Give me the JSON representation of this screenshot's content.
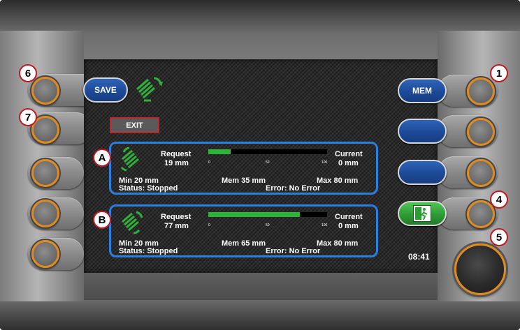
{
  "callouts": [
    "6",
    "7",
    "A",
    "B",
    "1",
    "4",
    "5"
  ],
  "softkeys": {
    "save_label": "SAVE",
    "mem_label": "MEM",
    "exit_label": "EXIT"
  },
  "panels": [
    {
      "marker": "A",
      "request_label": "Request",
      "request_value": "19 mm",
      "current_label": "Current",
      "current_value": "0 mm",
      "bar_fraction": 0.19,
      "tick_0": "0",
      "tick_50": "50",
      "tick_100": "100",
      "min": "Min 20 mm",
      "mem": "Mem 35 mm",
      "max": "Max 80 mm",
      "status": "Status: Stopped",
      "error": "Error: No Error"
    },
    {
      "marker": "B",
      "request_label": "Request",
      "request_value": "77 mm",
      "current_label": "Current",
      "current_value": "0 mm",
      "bar_fraction": 0.77,
      "tick_0": "0",
      "tick_50": "50",
      "tick_100": "100",
      "min": "Min 20 mm",
      "mem": "Mem 65 mm",
      "max": "Max 80 mm",
      "status": "Status: Stopped",
      "error": "Error: No Error"
    }
  ],
  "clock": "08:41",
  "icons": {
    "header": "brush-rotate-icon",
    "panel": "brush-rotate-icon",
    "exit": "emergency-exit-icon"
  },
  "colors": {
    "accent": "#2a7fe0",
    "softkey_blue": "#1d4a98",
    "exit_green": "#2e9c35",
    "bar_fill": "#2fb23a",
    "ring_orange": "#e08a22",
    "callout_red": "#c0191f"
  }
}
